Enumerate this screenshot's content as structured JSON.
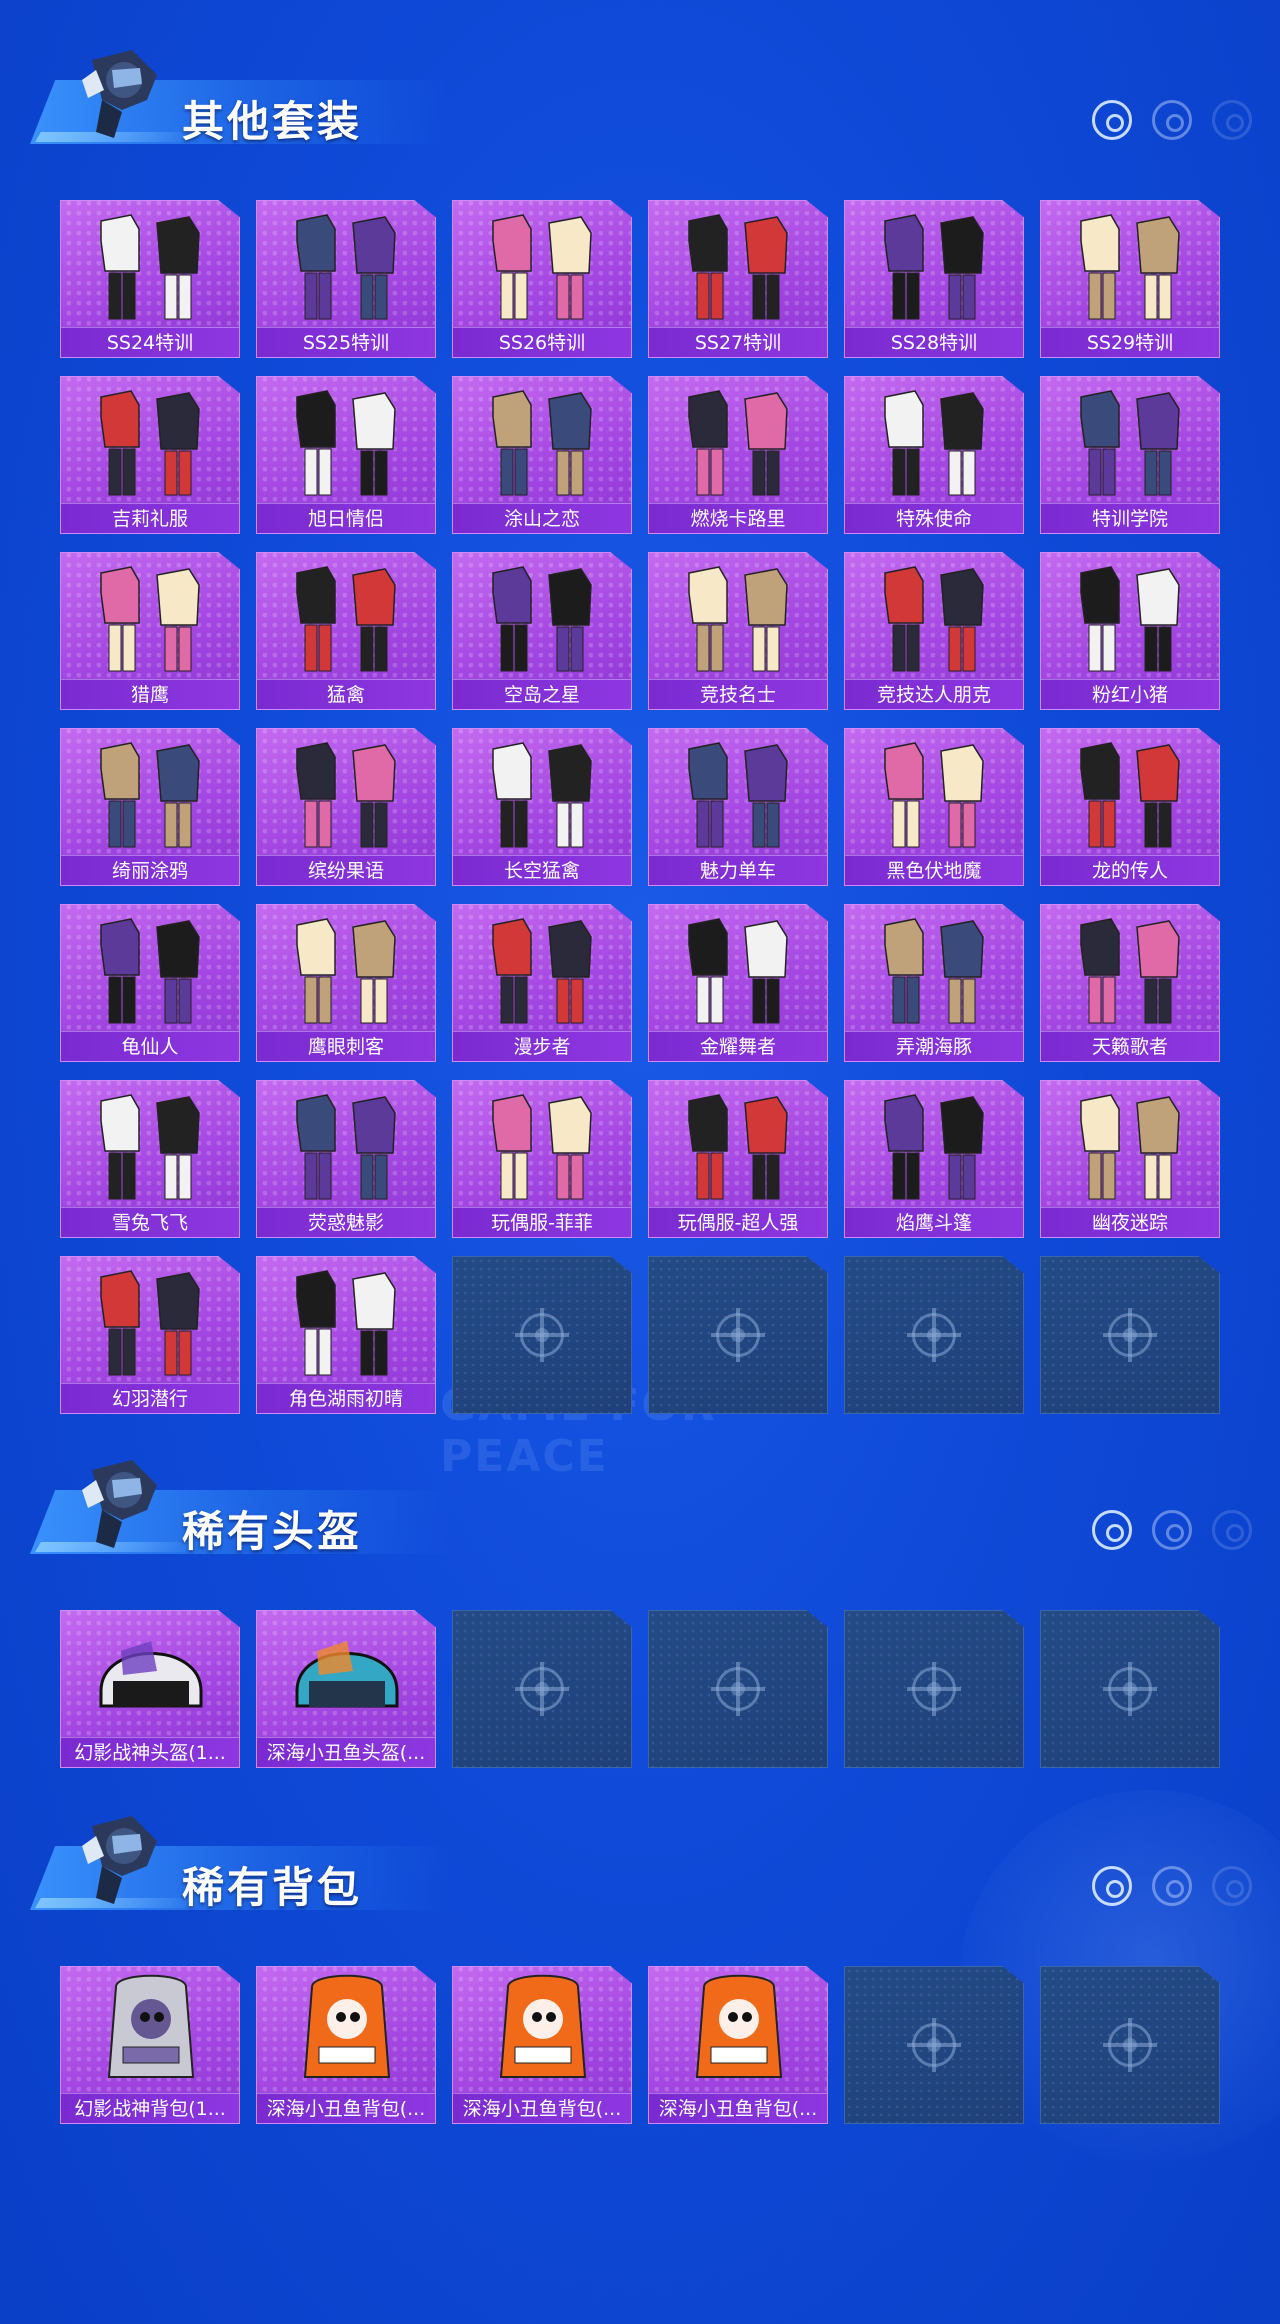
{
  "sections": [
    {
      "title": "其他套装",
      "items": [
        {
          "label": "SS24特训",
          "art": "outfit"
        },
        {
          "label": "SS25特训",
          "art": "outfit"
        },
        {
          "label": "SS26特训",
          "art": "outfit"
        },
        {
          "label": "SS27特训",
          "art": "outfit"
        },
        {
          "label": "SS28特训",
          "art": "outfit"
        },
        {
          "label": "SS29特训",
          "art": "outfit"
        },
        {
          "label": "吉莉礼服",
          "art": "outfit"
        },
        {
          "label": "旭日情侣",
          "art": "outfit"
        },
        {
          "label": "涂山之恋",
          "art": "outfit"
        },
        {
          "label": "燃烧卡路里",
          "art": "outfit"
        },
        {
          "label": "特殊使命",
          "art": "outfit"
        },
        {
          "label": "特训学院",
          "art": "outfit"
        },
        {
          "label": "猎鹰",
          "art": "outfit"
        },
        {
          "label": "猛禽",
          "art": "outfit"
        },
        {
          "label": "空岛之星",
          "art": "outfit"
        },
        {
          "label": "竞技名士",
          "art": "outfit"
        },
        {
          "label": "竞技达人朋克",
          "art": "outfit"
        },
        {
          "label": "粉红小猪",
          "art": "outfit"
        },
        {
          "label": "绮丽涂鸦",
          "art": "outfit"
        },
        {
          "label": "缤纷果语",
          "art": "outfit"
        },
        {
          "label": "长空猛禽",
          "art": "outfit"
        },
        {
          "label": "魅力单车",
          "art": "outfit"
        },
        {
          "label": "黑色伏地魔",
          "art": "outfit"
        },
        {
          "label": "龙的传人",
          "art": "outfit"
        },
        {
          "label": "龟仙人",
          "art": "outfit"
        },
        {
          "label": "鹰眼刺客",
          "art": "outfit"
        },
        {
          "label": "漫步者",
          "art": "outfit"
        },
        {
          "label": "金耀舞者",
          "art": "outfit"
        },
        {
          "label": "弄潮海豚",
          "art": "outfit"
        },
        {
          "label": "天籁歌者",
          "art": "outfit"
        },
        {
          "label": "雪兔飞飞",
          "art": "outfit"
        },
        {
          "label": "荧惑魅影",
          "art": "outfit"
        },
        {
          "label": "玩偶服-菲菲",
          "art": "outfit"
        },
        {
          "label": "玩偶服-超人强",
          "art": "outfit"
        },
        {
          "label": "焰鹰斗篷",
          "art": "outfit"
        },
        {
          "label": "幽夜迷踪",
          "art": "outfit"
        },
        {
          "label": "幻羽潜行",
          "art": "outfit"
        },
        {
          "label": "角色湖雨初晴",
          "art": "outfit"
        }
      ],
      "empty_slots": 4
    },
    {
      "title": "稀有头盔",
      "items": [
        {
          "label": "幻影战神头盔(1...",
          "art": "helmet"
        },
        {
          "label": "深海小丑鱼头盔(...",
          "art": "helmet"
        }
      ],
      "empty_slots": 4
    },
    {
      "title": "稀有背包",
      "items": [
        {
          "label": "幻影战神背包(1...",
          "art": "backpack"
        },
        {
          "label": "深海小丑鱼背包(...",
          "art": "backpack"
        },
        {
          "label": "深海小丑鱼背包(...",
          "art": "backpack"
        },
        {
          "label": "深海小丑鱼背包(...",
          "art": "backpack"
        }
      ],
      "empty_slots": 2
    }
  ],
  "watermark": "GAME FOR PEACE",
  "colors": {
    "background": "#0f4ad8",
    "tile_filled": "#a447e2",
    "tile_label": "#7a2ad0",
    "tile_empty": "#244b86"
  }
}
